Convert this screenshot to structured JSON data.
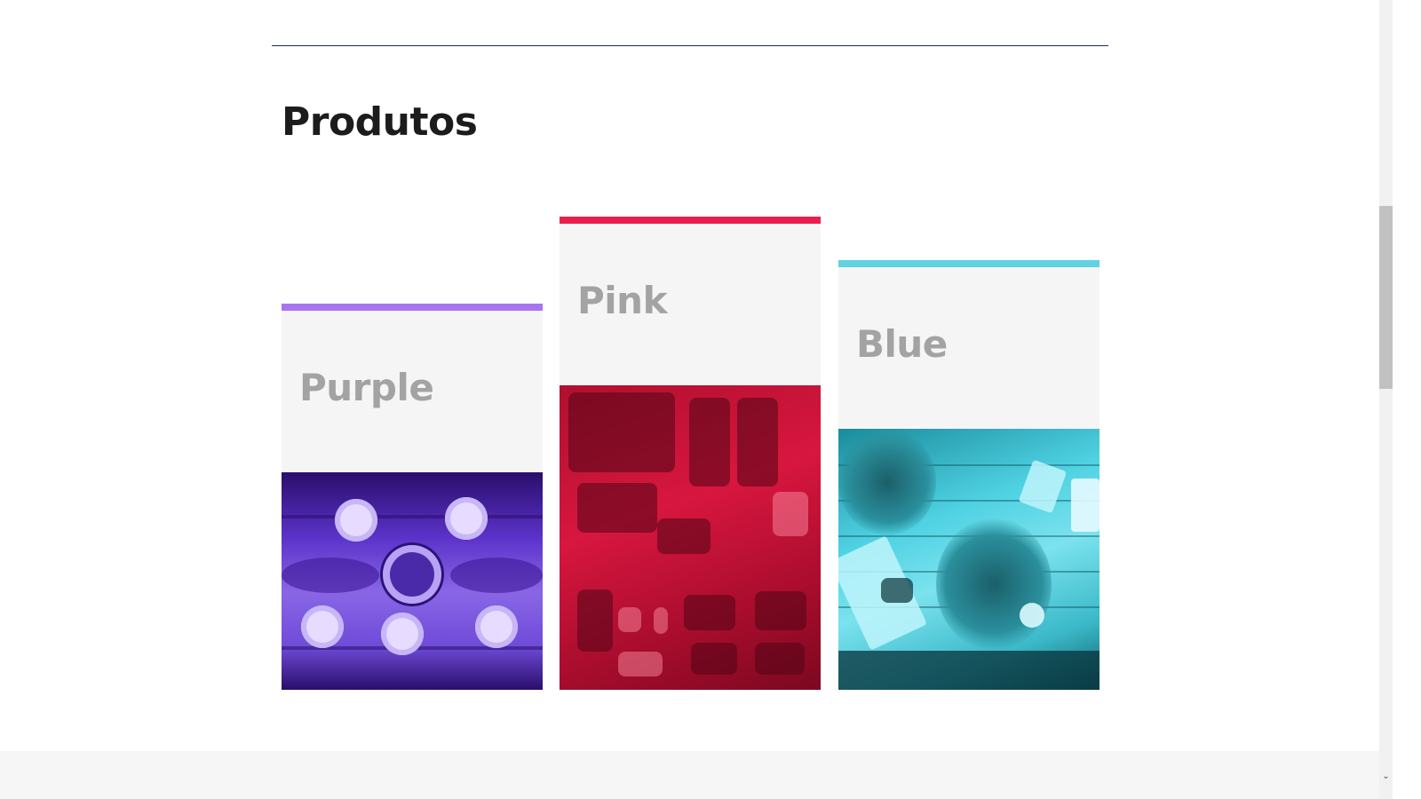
{
  "section": {
    "title": "Produtos"
  },
  "cards": [
    {
      "title": "Purple",
      "accent_color": "#a974ef",
      "image": "purple-table-setting-photo"
    },
    {
      "title": "Pink",
      "accent_color": "#ea1f4f",
      "image": "pink-travel-gear-photo"
    },
    {
      "title": "Blue",
      "accent_color": "#5fd3e2",
      "image": "blue-flowers-desk-photo"
    }
  ],
  "scrollbar": {
    "down_arrow": "⌄"
  }
}
